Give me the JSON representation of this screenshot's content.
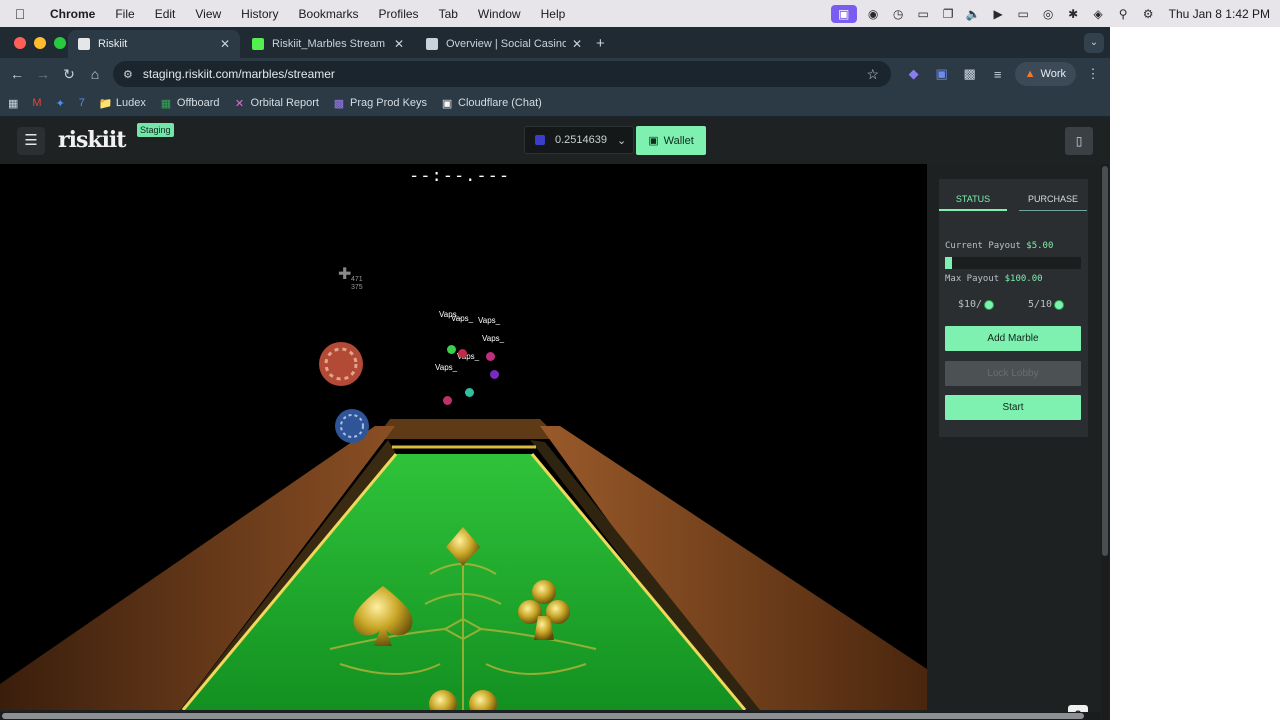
{
  "menubar": {
    "app": "Chrome",
    "items": [
      "File",
      "Edit",
      "View",
      "History",
      "Bookmarks",
      "Profiles",
      "Tab",
      "Window",
      "Help"
    ],
    "clock": "Thu Jan 8  1:42 PM"
  },
  "browser": {
    "tabs": [
      {
        "title": "Riskiit",
        "favicon_color": "#e6e6e6"
      },
      {
        "title": "Riskiit_Marbles Stream - Wa",
        "favicon_color": "#53f04f"
      },
      {
        "title": "Overview | Social Casino",
        "favicon_color": "#c9d3dc"
      }
    ],
    "url": "staging.riskiit.com/marbles/streamer",
    "profile_label": "Work",
    "bookmarks": [
      "Ludex",
      "Offboard",
      "Orbital Report",
      "Prag Prod Keys",
      "Cloudflare (Chat)"
    ]
  },
  "header": {
    "logo": "riskiit",
    "staging_badge": "Staging",
    "balance": "0.2514639",
    "wallet_label": "Wallet"
  },
  "game": {
    "timer": "--:--.---",
    "coord_x": "471",
    "coord_y": "375",
    "marble_names": [
      "Vaps_",
      "Vaps_",
      "Vaps_",
      "Vaps_",
      "Vaps_",
      "Vaps_"
    ]
  },
  "sidebar": {
    "tabs": [
      "STATUS",
      "PURCHASE"
    ],
    "active_tab": "STATUS",
    "current_payout_label": "Current Payout",
    "current_payout_value": "$5.00",
    "payout_progress": 0.05,
    "max_payout_label": "Max Payout",
    "max_payout_value": "$100.00",
    "entry_fee": "$10/",
    "slots": "5/10",
    "add_marble_label": "Add Marble",
    "lock_lobby_label": "Lock Lobby",
    "start_label": "Start"
  },
  "colors": {
    "accent": "#7ef0b0",
    "felt": "#1f9a2b",
    "rail": "#7a4420",
    "gold": "#c9a626"
  }
}
